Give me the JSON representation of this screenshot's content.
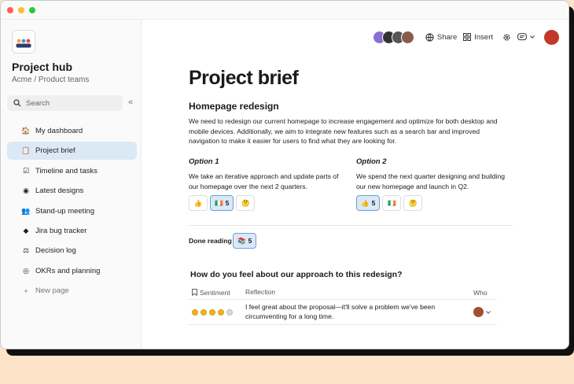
{
  "window": {
    "traffic_colors": [
      "#ff5f57",
      "#febc2e",
      "#28c840"
    ]
  },
  "sidebar": {
    "title": "Project hub",
    "subtitle": "Acme / Product teams",
    "search_placeholder": "Search",
    "collapse_glyph": "«",
    "items": [
      {
        "label": "My dashboard",
        "icon": "house-icon",
        "glyph": "🏠",
        "active": false
      },
      {
        "label": "Project brief",
        "icon": "document-icon",
        "glyph": "📋",
        "active": true
      },
      {
        "label": "Timeline and tasks",
        "icon": "checklist-icon",
        "glyph": "☑",
        "active": false
      },
      {
        "label": "Latest designs",
        "icon": "figma-icon",
        "glyph": "◉",
        "active": false
      },
      {
        "label": "Stand-up meeting",
        "icon": "people-icon",
        "glyph": "👥",
        "active": false
      },
      {
        "label": "Jira bug tracker",
        "icon": "jira-icon",
        "glyph": "◆",
        "active": false
      },
      {
        "label": "Decision log",
        "icon": "gavel-icon",
        "glyph": "⚖",
        "active": false
      },
      {
        "label": "OKRs and planning",
        "icon": "target-icon",
        "glyph": "◎",
        "active": false
      },
      {
        "label": "New page",
        "icon": "plus-icon",
        "glyph": "+",
        "active": false
      }
    ]
  },
  "topbar": {
    "share_label": "Share",
    "insert_label": "Insert",
    "avatar_colors": [
      "#8a6fd1",
      "#333333",
      "#555555",
      "#8a5a4a"
    ],
    "user_avatar_color": "#c0392b"
  },
  "doc": {
    "title": "Project brief",
    "section_title": "Homepage redesign",
    "paragraph": "We need to redesign our current homepage to increase engagement and optimize for both desktop and mobile devices. Additionally, we aim to integrate new features such as a search bar and improved navigation to make it easier for users to find what they are looking for.",
    "option1": {
      "title": "Option 1",
      "text": "We take an iterative approach and update parts of our homepage over the next 2 quarters.",
      "reactions": [
        {
          "glyph": "👍",
          "count": ""
        },
        {
          "glyph": "🇮🇪",
          "count": "5",
          "selected": true
        },
        {
          "glyph": "🤔",
          "count": ""
        }
      ]
    },
    "option2": {
      "title": "Option 2",
      "text": "We spend the next quarter designing and building our new homepage and launch in Q2.",
      "reactions": [
        {
          "glyph": "👍",
          "count": "5",
          "selected": true
        },
        {
          "glyph": "🇮🇪",
          "count": ""
        },
        {
          "glyph": "🤔",
          "count": ""
        }
      ]
    },
    "done_reading": {
      "label": "Done reading",
      "glyph": "📚",
      "count": "5"
    },
    "question": "How do you feel about our approach to this redesign?",
    "table": {
      "headers": {
        "sentiment": "Sentiment",
        "reflection": "Reflection",
        "who": "Who"
      },
      "rows": [
        {
          "sentiment_filled": 4,
          "sentiment_total": 5,
          "reflection": "I feel great about the proposal—it'll solve a problem we've been circumventing for a long time.",
          "who_color": "#a0522d"
        }
      ]
    }
  }
}
